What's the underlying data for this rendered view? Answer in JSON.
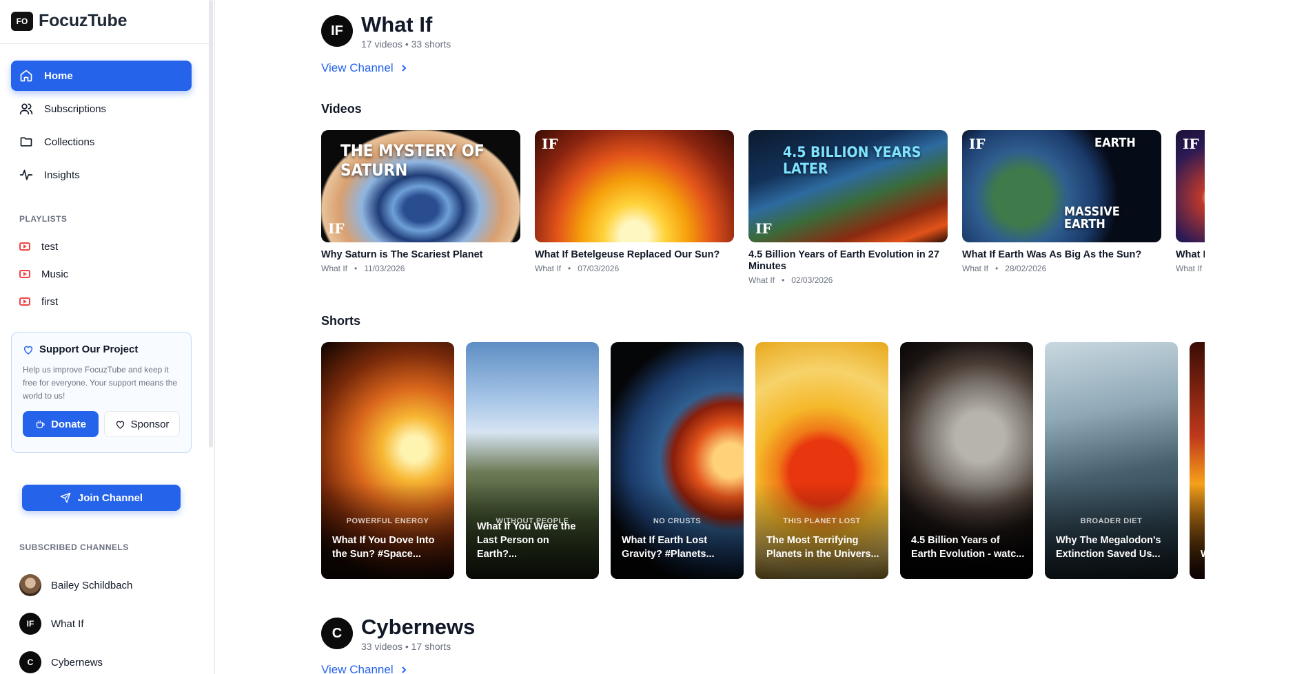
{
  "app": {
    "name": "FocuzTube",
    "logo_text": "FO"
  },
  "nav": [
    {
      "label": "Home",
      "icon": "home-icon",
      "active": true
    },
    {
      "label": "Subscriptions",
      "icon": "users-icon"
    },
    {
      "label": "Collections",
      "icon": "folder-icon"
    },
    {
      "label": "Insights",
      "icon": "activity-icon"
    }
  ],
  "playlists": {
    "label": "PLAYLISTS",
    "items": [
      "test",
      "Music",
      "first"
    ]
  },
  "support": {
    "title": "Support Our Project",
    "text": "Help us improve FocuzTube and keep it free for everyone. Your support means the world to us!",
    "donate": "Donate",
    "sponsor": "Sponsor"
  },
  "join_channel": "Join Channel",
  "subscribed": {
    "label": "SUBSCRIBED CHANNELS",
    "items": [
      "Bailey Schildbach",
      "What If",
      "Cybernews"
    ]
  },
  "channel1": {
    "name": "What If",
    "meta": "17 videos • 33 shorts",
    "view_channel": "View Channel",
    "logo": "IF"
  },
  "sections": {
    "videos": "Videos",
    "shorts": "Shorts"
  },
  "videos": [
    {
      "title": "Why Saturn is The Scariest Planet",
      "channel": "What If",
      "date": "11/03/2026",
      "thumb_text": "THE MYSTERY OF SATURN",
      "badge": "IF"
    },
    {
      "title": "What If Betelgeuse Replaced Our Sun?",
      "channel": "What If",
      "date": "07/03/2026",
      "thumb_text": "",
      "badge": "IF"
    },
    {
      "title": "4.5 Billion Years of Earth Evolution in 27 Minutes",
      "channel": "What If",
      "date": "02/03/2026",
      "thumb_text": "4.5 BILLION YEARS LATER",
      "badge": "IF"
    },
    {
      "title": "What If Earth Was As Big As the Sun?",
      "channel": "What If",
      "date": "28/02/2026",
      "thumb_text": "EARTH",
      "thumb_text2": "MASSIVE EARTH",
      "badge": "IF"
    },
    {
      "title": "What If Bang?",
      "channel": "What If",
      "date": "",
      "thumb_text": "",
      "badge": "IF"
    }
  ],
  "shorts": [
    {
      "caption": "POWERFUL ENERGY",
      "title": "What If You Dove Into the Sun? #Space..."
    },
    {
      "caption": "WITHOUT PEOPLE",
      "title": "What If You Were the Last Person on Earth?..."
    },
    {
      "caption": "NO CRUSTS",
      "title": "What If Earth Lost Gravity? #Planets..."
    },
    {
      "caption": "THIS PLANET LOST",
      "title": "The Most Terrifying Planets in the Univers..."
    },
    {
      "caption": "",
      "title": "4.5 Billion Years of Earth Evolution - watc..."
    },
    {
      "caption": "BROADER DIET",
      "title": "Why The Megalodon's Extinction Saved Us..."
    },
    {
      "caption": "",
      "title": "W O"
    }
  ],
  "channel2": {
    "name": "Cybernews",
    "meta": "33 videos • 17 shorts",
    "view_channel": "View Channel",
    "logo": "C"
  },
  "colors": {
    "accent": "#2563eb",
    "playlist_icon": "#ef4444"
  }
}
